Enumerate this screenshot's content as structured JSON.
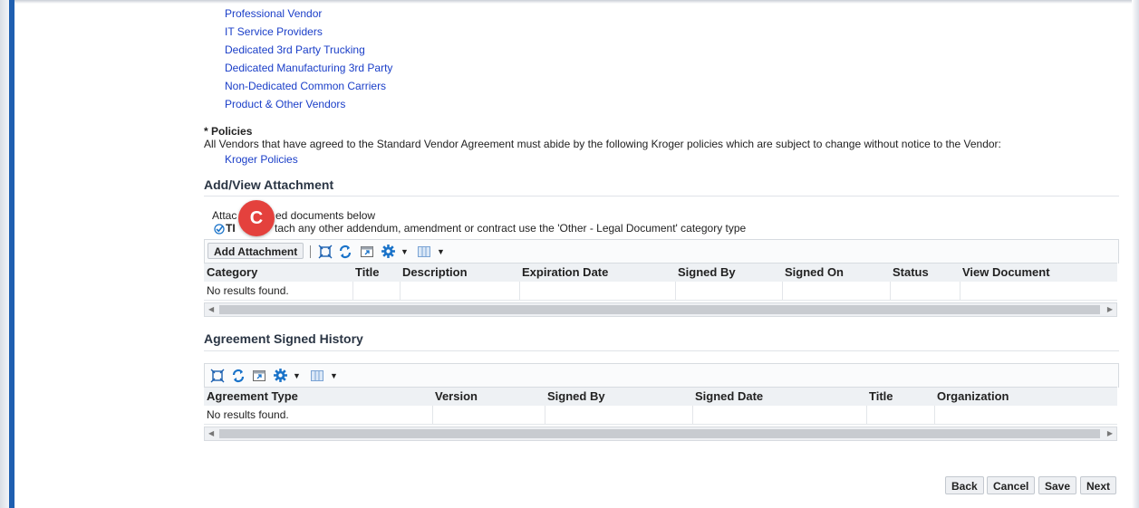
{
  "vendor_links": [
    "Professional Vendor",
    "IT Service Providers",
    "Dedicated 3rd Party Trucking",
    "Dedicated Manufacturing 3rd Party",
    "Non-Dedicated Common Carriers",
    "Product & Other Vendors"
  ],
  "policies": {
    "label": "* Policies",
    "description": "All Vendors that have agreed to the Standard Vendor Agreement must abide by the following Kroger policies which are subject to change without notice to the Vendor:",
    "link": "Kroger Policies"
  },
  "attachments": {
    "title": "Add/View Attachment",
    "instruction": "Attach signed documents below",
    "instruction_visible_start": "Attac",
    "instruction_visible_end": "ed documents below",
    "tip_start": "TI",
    "tip_end": "tach any other addendum, amendment or contract use the 'Other - Legal Document' category type",
    "add_button": "Add Attachment",
    "columns": [
      "Category",
      "Title",
      "Description",
      "Expiration Date",
      "Signed By",
      "Signed On",
      "Status",
      "View Document"
    ],
    "empty_text": "No results found."
  },
  "history": {
    "title": "Agreement Signed History",
    "columns": [
      "Agreement Type",
      "Version",
      "Signed By",
      "Signed Date",
      "Title",
      "Organization"
    ],
    "empty_text": "No results found."
  },
  "step_badge": "C",
  "footer": {
    "back": "Back",
    "cancel": "Cancel",
    "save": "Save",
    "next": "Next"
  },
  "icons": [
    "detach-icon",
    "refresh-icon",
    "export-icon",
    "settings-gear-icon",
    "columns-icon",
    "tip-check-icon"
  ],
  "colors": {
    "link": "#1a3ec8",
    "accent_bar": "#1f5fb0",
    "badge": "#e4413d",
    "icon_blue": "#1a73c9"
  }
}
